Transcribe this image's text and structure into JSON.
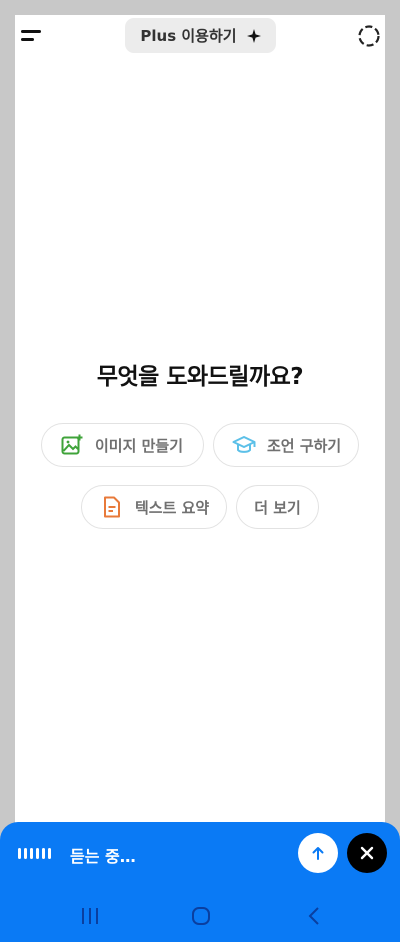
{
  "header": {
    "plus_label": "Plus 이용하기",
    "icons": [
      "menu-icon",
      "sparkle-icon",
      "temporary-chat-icon"
    ]
  },
  "main": {
    "headline": "무엇을 도와드릴까요?",
    "chips": [
      {
        "label": "이미지 만들기",
        "icon": "image-create-icon",
        "color": "#3fa33a"
      },
      {
        "label": "조언 구하기",
        "icon": "graduation-cap-icon",
        "color": "#5cc0e8"
      },
      {
        "label": "텍스트 요약",
        "icon": "document-icon",
        "color": "#e87a3a"
      },
      {
        "label": "더 보기",
        "icon": "",
        "color": ""
      }
    ]
  },
  "voice": {
    "status": "듣는 중…",
    "accent": "#0a7af5"
  },
  "navbar": {
    "icons": [
      "recent-apps-icon",
      "home-icon",
      "back-icon"
    ]
  }
}
